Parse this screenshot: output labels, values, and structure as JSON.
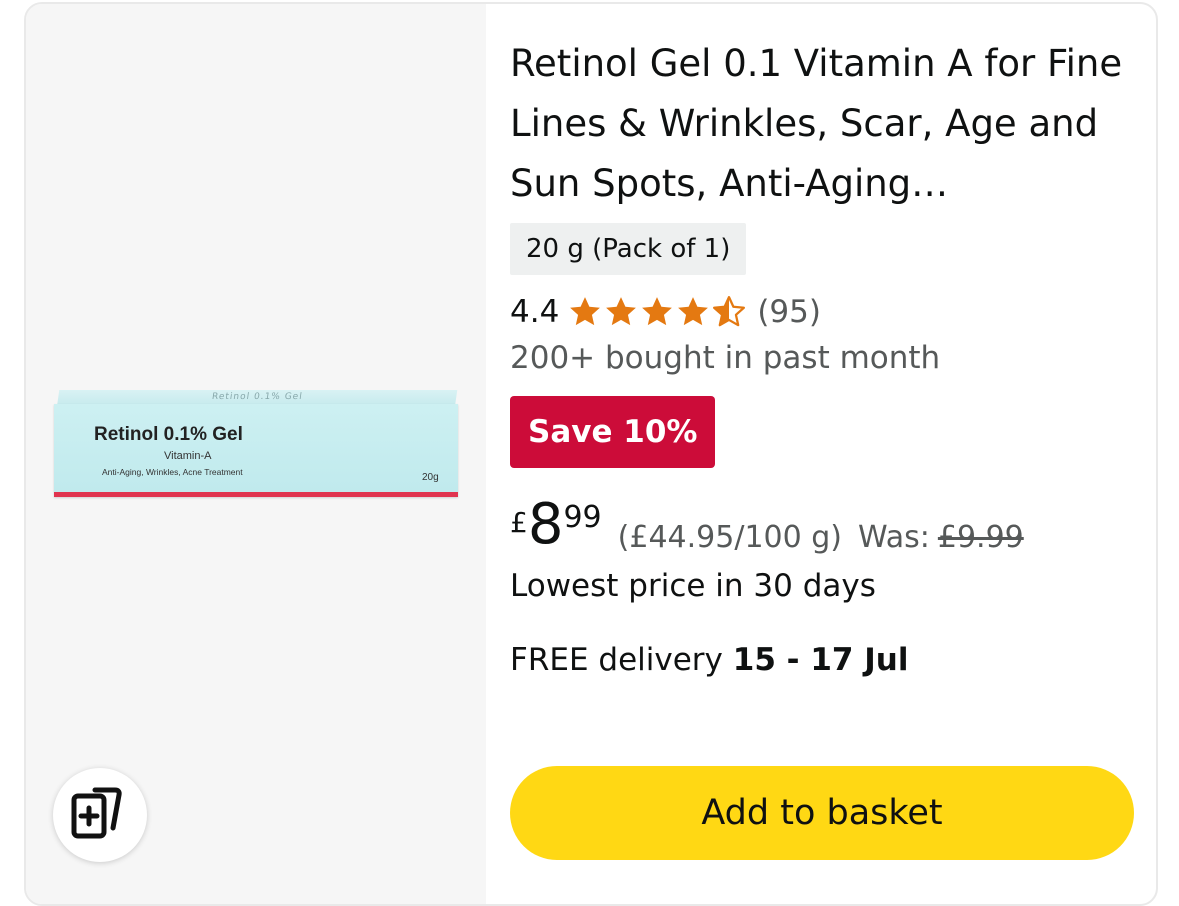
{
  "product": {
    "title": "Retinol Gel 0.1 Vitamin A for Fine Lines & Wrinkles, Scar, Age and Sun Spots, Anti-Aging…",
    "variant": "20 g (Pack of 1)",
    "rating": "4.4",
    "rating_value": 4.4,
    "rating_count": "(95)",
    "bought": "200+ bought in past month",
    "save_badge": "Save 10%",
    "price_currency": "£",
    "price_whole": "8",
    "price_fraction": "99",
    "unit_price": "(£44.95/100 g)",
    "was_label": "Was:",
    "was_price": "£9.99",
    "lowest_price": "Lowest price in 30 days",
    "delivery_label": "FREE delivery",
    "delivery_date": "15 - 17 Jul",
    "add_to_basket": "Add to basket"
  },
  "image": {
    "box_top": "Retinol 0.1% Gel",
    "box_name": "Retinol 0.1% Gel",
    "box_sub": "Vitamin-A",
    "box_desc": "Anti-Aging, Wrinkles, Acne Treatment",
    "box_weight": "20g"
  },
  "icons": {
    "compare": "compare-cards-icon",
    "star_full": "star-full-icon",
    "star_half": "star-half-icon"
  },
  "colors": {
    "star": "#e47911",
    "save_badge": "#cc0c39",
    "add_button": "#ffd814",
    "image_bg": "#f6f6f6"
  }
}
